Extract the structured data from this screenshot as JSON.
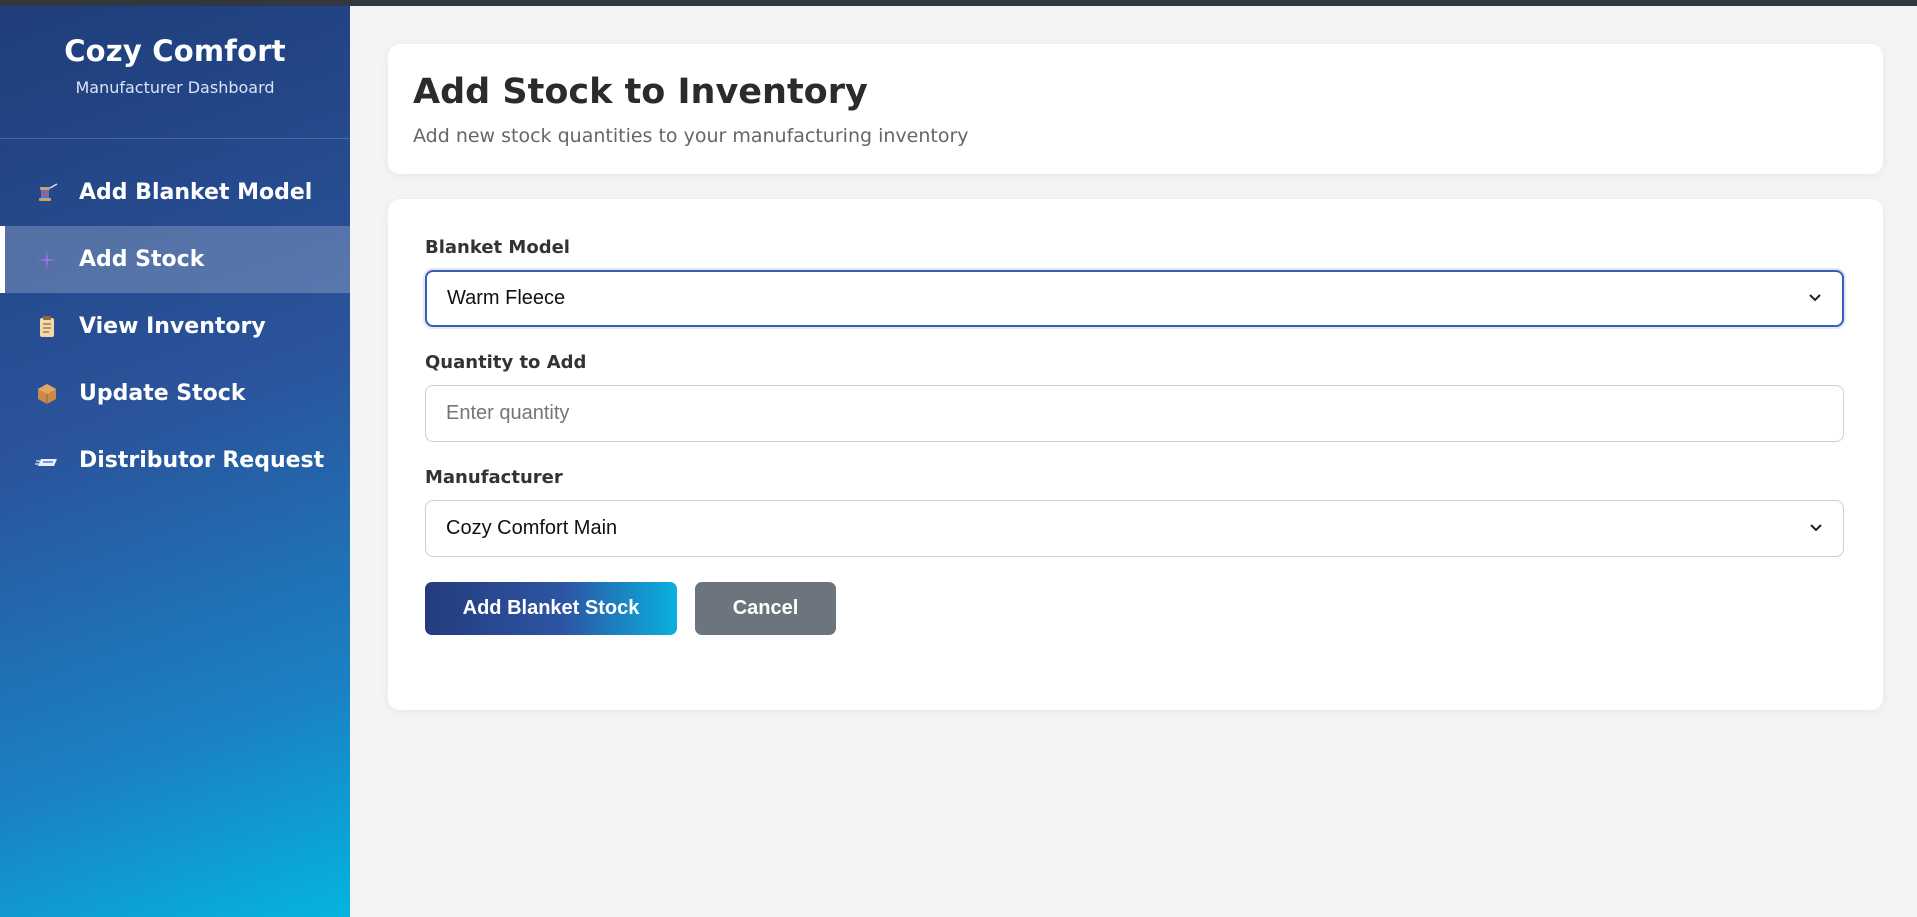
{
  "sidebar": {
    "brand_title": "Cozy Comfort",
    "brand_subtitle": "Manufacturer Dashboard",
    "items": [
      {
        "label": "Add Blanket Model",
        "icon": "thread-spool-icon"
      },
      {
        "label": "Add Stock",
        "icon": "plus-sparkle-icon",
        "active": true
      },
      {
        "label": "View Inventory",
        "icon": "clipboard-icon"
      },
      {
        "label": "Update Stock",
        "icon": "package-icon"
      },
      {
        "label": "Distributor Request",
        "icon": "delivery-icon"
      }
    ]
  },
  "header": {
    "title": "Add Stock to Inventory",
    "subtitle": "Add new stock quantities to your manufacturing inventory"
  },
  "form": {
    "blanket_model_label": "Blanket Model",
    "blanket_model_value": "Warm Fleece",
    "quantity_label": "Quantity to Add",
    "quantity_placeholder": "Enter quantity",
    "manufacturer_label": "Manufacturer",
    "manufacturer_value": "Cozy Comfort Main",
    "submit_label": "Add Blanket Stock",
    "cancel_label": "Cancel"
  },
  "colors": {
    "sidebar_top": "#1f3d7a",
    "sidebar_bottom": "#05b4e0",
    "cancel_button": "#6c757d",
    "focus_border": "#3d5bb8"
  }
}
